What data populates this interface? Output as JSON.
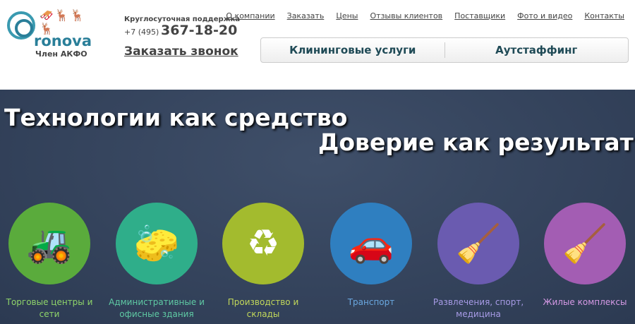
{
  "logo": {
    "word": "ronova",
    "sub": "Член АКФО"
  },
  "contact": {
    "support": "Круглосуточная поддержка",
    "phone_prefix": "+7 (495)",
    "phone": "367-18-20",
    "callback": "Заказать звонок"
  },
  "nav": [
    "О компании",
    "Заказать",
    "Цены",
    "Отзывы клиентов",
    "Поставщики",
    "Фото и видео",
    "Контакты"
  ],
  "services": [
    "Клининговые услуги",
    "Аутстаффинг"
  ],
  "hero": {
    "line1": "Технологии как средство",
    "line2": "Доверие как результат"
  },
  "segments": [
    {
      "label": "Торговые центры и сети",
      "color": "#5aab3c",
      "text_color": "#8fd46a",
      "icon": "floor-scrubber-icon",
      "glyph": "🚜"
    },
    {
      "label": "Административные и офисные здания",
      "color": "#2fae8a",
      "text_color": "#5fcaa4",
      "icon": "window-cleaner-icon",
      "glyph": "🧽"
    },
    {
      "label": "Производство и склады",
      "color": "#a3bb2e",
      "text_color": "#c2d85a",
      "icon": "recycling-cart-icon",
      "glyph": "♻"
    },
    {
      "label": "Транспорт",
      "color": "#2f7fc0",
      "text_color": "#6aa8e0",
      "icon": "car-wash-icon",
      "glyph": "🚗"
    },
    {
      "label": "Развлечения, спорт, медицина",
      "color": "#6a5bb0",
      "text_color": "#a79be6",
      "icon": "cleaning-cart-icon",
      "glyph": "🧹"
    },
    {
      "label": "Жилые комплексы",
      "color": "#a35db3",
      "text_color": "#d69ae6",
      "icon": "vacuum-cleaner-icon",
      "glyph": "🧹"
    }
  ]
}
